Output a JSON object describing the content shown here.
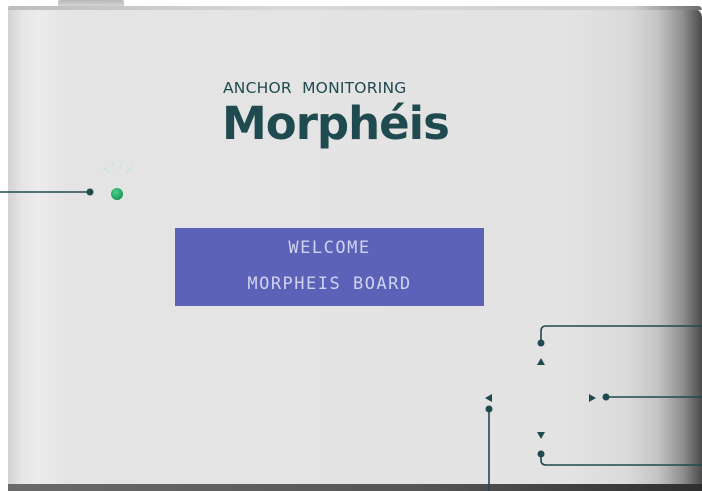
{
  "device": {
    "brand_line": "ANCHOR  MONITORING",
    "logo_text": "Morphéis",
    "accent_color": "#1f4a4f",
    "led_color": "#23b06a",
    "lcd_color": "#5c62b8"
  },
  "lcd": {
    "line_1": "WELCOME",
    "line_2": "MORPHEIS BOARD"
  },
  "navigation": {
    "up_icon": "triangle-up-icon",
    "down_icon": "triangle-down-icon",
    "left_icon": "triangle-left-icon",
    "right_icon": "triangle-right-icon"
  }
}
